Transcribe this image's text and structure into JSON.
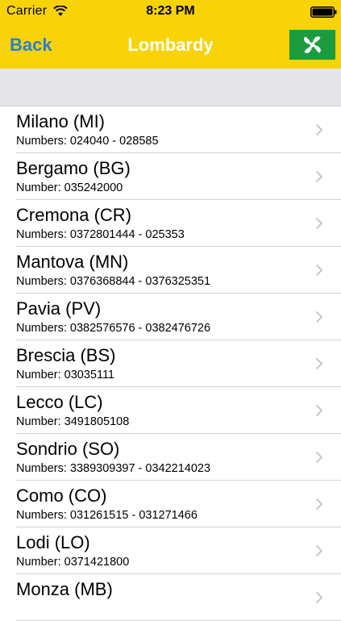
{
  "status_bar": {
    "carrier": "Carrier",
    "time": "8:23 PM",
    "icons": [
      "wifi-icon",
      "battery-icon"
    ]
  },
  "nav": {
    "back_label": "Back",
    "title": "Lombardy",
    "flag_icon": "lombardy-flag-icon"
  },
  "colors": {
    "bar": "#f8d307",
    "back": "#2a7fd1",
    "flag_green": "#1c9c3f",
    "section_bg": "#e6e6ea"
  },
  "rows": [
    {
      "title": "Milano (MI)",
      "subtitle": "Numbers: 024040 - 028585"
    },
    {
      "title": "Bergamo (BG)",
      "subtitle": "Number: 035242000"
    },
    {
      "title": "Cremona (CR)",
      "subtitle": "Numbers: 0372801444 - 025353"
    },
    {
      "title": "Mantova (MN)",
      "subtitle": "Numbers: 0376368844 - 0376325351"
    },
    {
      "title": "Pavia (PV)",
      "subtitle": "Numbers: 0382576576 - 0382476726"
    },
    {
      "title": "Brescia (BS)",
      "subtitle": "Number: 03035111"
    },
    {
      "title": "Lecco (LC)",
      "subtitle": "Number: 3491805108"
    },
    {
      "title": "Sondrio (SO)",
      "subtitle": "Numbers: 3389309397 - 0342214023"
    },
    {
      "title": "Como (CO)",
      "subtitle": "Numbers: 031261515 - 031271466"
    },
    {
      "title": "Lodi (LO)",
      "subtitle": "Number: 0371421800"
    },
    {
      "title": "Monza (MB)",
      "subtitle": ""
    }
  ]
}
